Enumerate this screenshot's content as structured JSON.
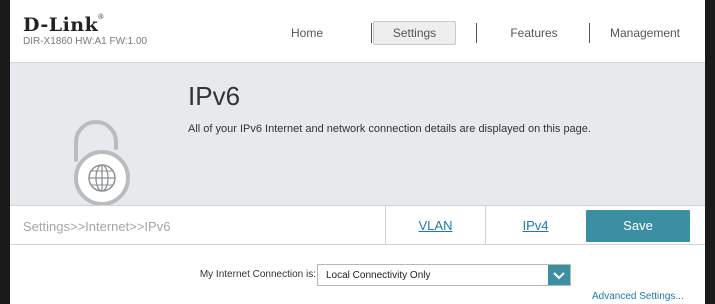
{
  "header": {
    "brand": "D-Link",
    "brand_mark": "®",
    "model_info": "DIR-X1860 HW:A1 FW:1.00",
    "nav": {
      "home": "Home",
      "settings": "Settings",
      "features": "Features",
      "management": "Management"
    }
  },
  "banner": {
    "title": "IPv6",
    "description": "All of your IPv6 Internet and network connection details are displayed on this page.",
    "icon": "lock-globe-icon"
  },
  "tabbar": {
    "breadcrumb": "Settings>>Internet>>IPv6",
    "tab_vlan": "VLAN",
    "tab_ipv4": "IPv4",
    "save": "Save"
  },
  "form": {
    "connection_label": "My Internet Connection is:",
    "connection_value": "Local Connectivity Only",
    "advanced_link": "Advanced Settings..."
  },
  "colors": {
    "accent": "#3c8fa3",
    "link": "#1d78b4",
    "banner_bg": "#e7e9ec"
  }
}
